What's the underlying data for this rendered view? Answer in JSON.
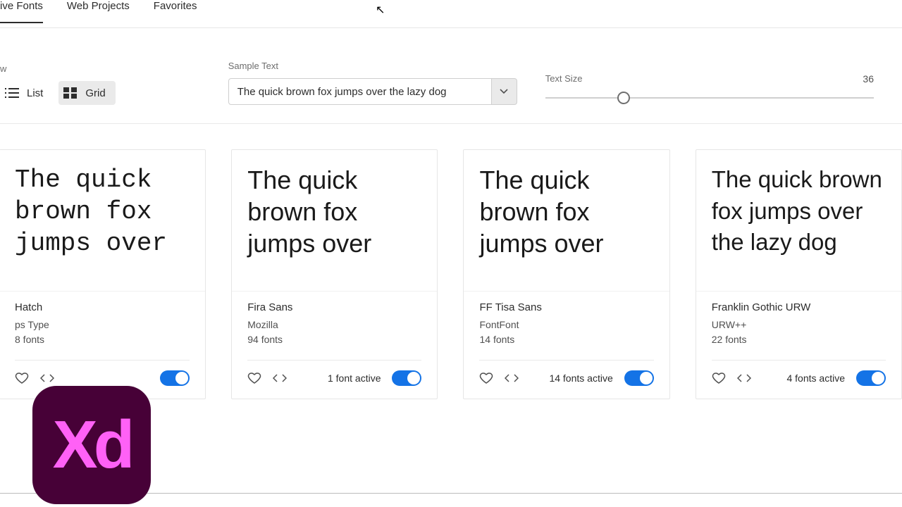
{
  "tabs": {
    "active": "ive Fonts",
    "web": "Web Projects",
    "favorites": "Favorites"
  },
  "view": {
    "label": "w",
    "list": "List",
    "grid": "Grid"
  },
  "sample": {
    "label": "Sample Text",
    "value": "The quick brown fox jumps over the lazy dog"
  },
  "size": {
    "label": "Text Size",
    "value": "36"
  },
  "cards": [
    {
      "preview": "The quick brown fox jumps over",
      "name": "Hatch",
      "foundry": "ps Type",
      "count": "8 fonts",
      "active": ""
    },
    {
      "preview": "The quick brown fox jumps over",
      "name": "Fira Sans",
      "foundry": "Mozilla",
      "count": "94 fonts",
      "active": "1 font active"
    },
    {
      "preview": "The quick brown fox jumps over",
      "name": "FF Tisa Sans",
      "foundry": "FontFont",
      "count": "14 fonts",
      "active": "14 fonts active"
    },
    {
      "preview": "The quick brown fox jumps over the lazy dog",
      "name": "Franklin Gothic URW",
      "foundry": "URW++",
      "count": "22 fonts",
      "active": "4 fonts active"
    }
  ],
  "logo": "Xd"
}
